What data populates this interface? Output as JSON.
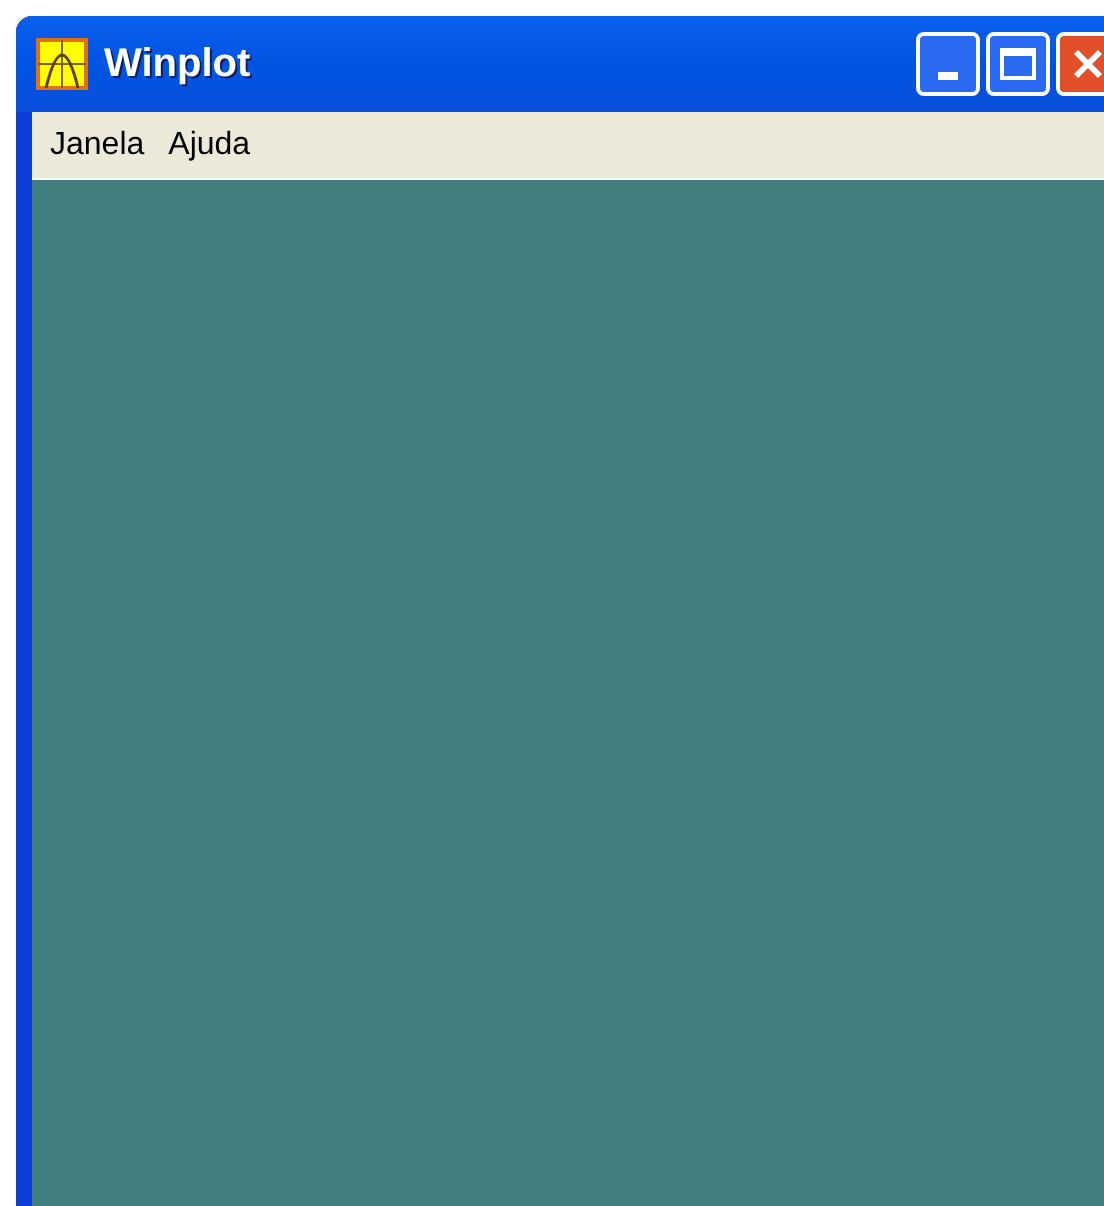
{
  "window": {
    "title": "Winplot"
  },
  "menu": [
    {
      "label": "Janela"
    },
    {
      "label": "Ajuda"
    }
  ]
}
